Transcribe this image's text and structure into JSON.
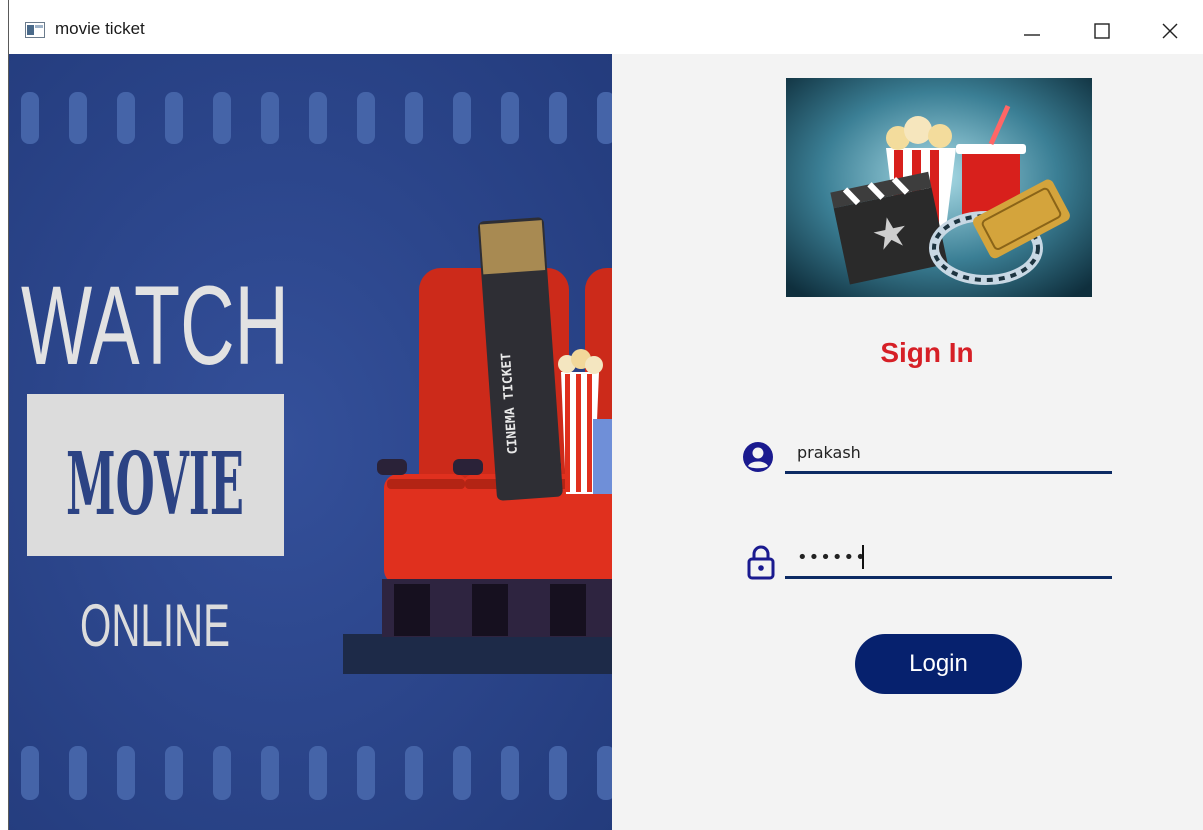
{
  "window": {
    "title": "movie ticket",
    "controls": {
      "minimize": "minimize",
      "maximize": "maximize",
      "close": "close"
    }
  },
  "banner": {
    "line1": "WATCH",
    "line2": "MOVIE",
    "line3": "ONLINE",
    "ticket_text": "CINEMA TICKET",
    "colors": {
      "background": "#2c4384",
      "seat_red": "#e0301e",
      "frame_stripe": "#4564a8"
    }
  },
  "login": {
    "title": "Sign In",
    "username_value": "prakash",
    "password_value": "••••••",
    "login_label": "Login",
    "colors": {
      "title": "#d61f26",
      "accent": "#0c2a63",
      "button": "#06216e",
      "icon": "#1a1a8f"
    }
  }
}
